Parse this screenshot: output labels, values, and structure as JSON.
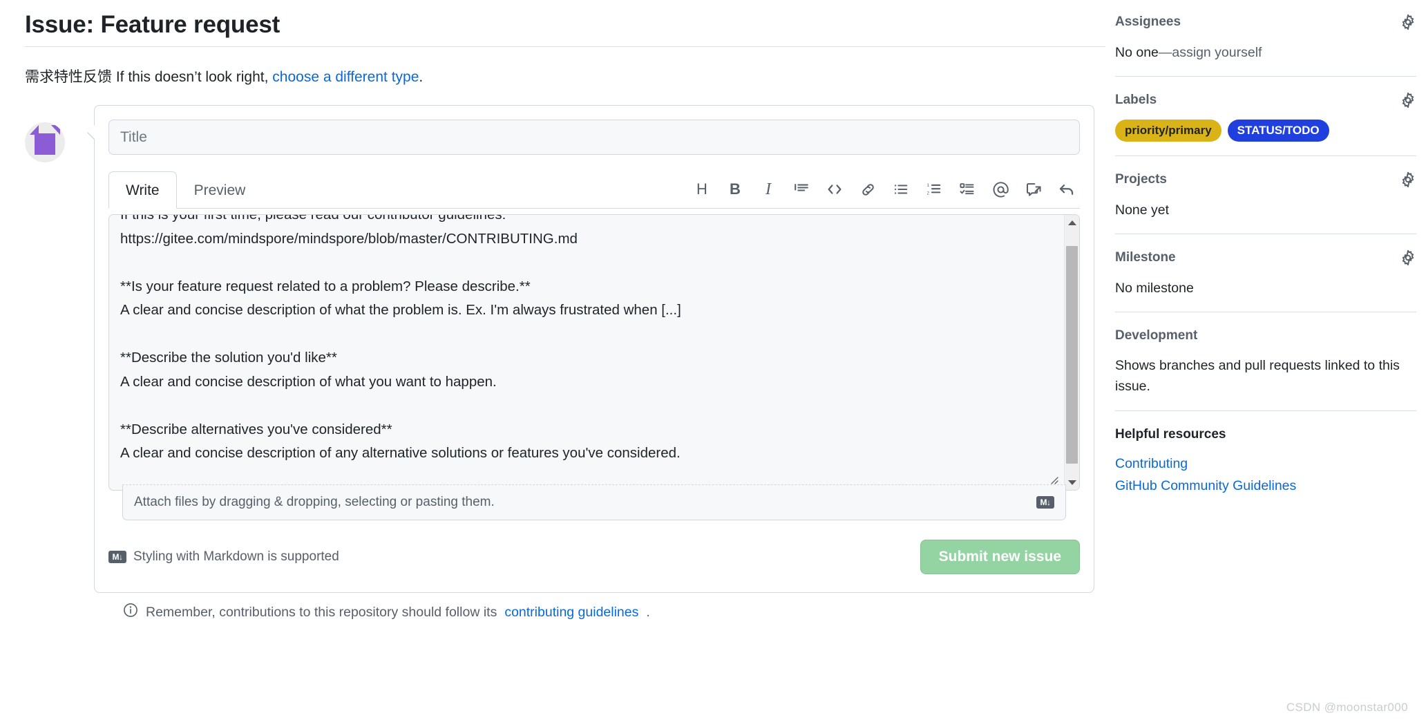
{
  "header": {
    "title": "Issue: Feature request",
    "subtitle_zh": "需求特性反馈",
    "subtitle_en": " If this doesn’t look right, ",
    "subtitle_link": "choose a different type",
    "subtitle_period": "."
  },
  "composer": {
    "title_placeholder": "Title",
    "tabs": [
      {
        "label": "Write",
        "active": true
      },
      {
        "label": "Preview",
        "active": false
      }
    ],
    "toolbar": [
      {
        "name": "heading-icon",
        "glyph": "H",
        "tooltip": "Add heading text"
      },
      {
        "name": "bold-icon",
        "glyph": "B",
        "tooltip": "Add bold text"
      },
      {
        "name": "italic-icon",
        "glyph": "I",
        "tooltip": "Add italic text"
      },
      {
        "name": "quote-icon",
        "glyph": "",
        "tooltip": "Add a quote"
      },
      {
        "name": "code-icon",
        "glyph": "<>",
        "tooltip": "Add code"
      },
      {
        "name": "link-icon",
        "glyph": "",
        "tooltip": "Add a link"
      },
      {
        "name": "unordered-list-icon",
        "glyph": "",
        "tooltip": "Add a bulleted list"
      },
      {
        "name": "ordered-list-icon",
        "glyph": "",
        "tooltip": "Add a numbered list"
      },
      {
        "name": "task-list-icon",
        "glyph": "",
        "tooltip": "Add a task list"
      },
      {
        "name": "mention-icon",
        "glyph": "@",
        "tooltip": "Directly mention a user or team"
      },
      {
        "name": "reference-icon",
        "glyph": "",
        "tooltip": "Reference an issue or pull request"
      },
      {
        "name": "saved-replies-icon",
        "glyph": "",
        "tooltip": "Add saved reply"
      }
    ],
    "body_text": "If this is your first time, please read our contributor guidelines:\nhttps://gitee.com/mindspore/mindspore/blob/master/CONTRIBUTING.md\n\n**Is your feature request related to a problem? Please describe.**\nA clear and concise description of what the problem is. Ex. I'm always frustrated when [...]\n\n**Describe the solution you'd like**\nA clear and concise description of what you want to happen.\n\n**Describe alternatives you've considered**\nA clear and concise description of any alternative solutions or features you've considered.\n\n**Additional context**\nAdd any other context or screenshots about the feature request here.",
    "attach_text": "Attach files by dragging & dropping, selecting or pasting them.",
    "markdown_badge": "M↓",
    "markdown_support": "Styling with Markdown is supported",
    "submit_label": "Submit new issue",
    "note_text": "Remember, contributions to this repository should follow its ",
    "note_link": "contributing guidelines",
    "note_period": "."
  },
  "sidebar": {
    "assignees": {
      "title": "Assignees",
      "value_prefix": "No one",
      "value_link": "—assign yourself"
    },
    "labels": {
      "title": "Labels",
      "chips": [
        {
          "text": "priority/primary",
          "bg": "#d9b318",
          "fg": "#1f2328"
        },
        {
          "text": "STATUS/TODO",
          "bg": "#1f3fdf",
          "fg": "#ffffff"
        }
      ]
    },
    "projects": {
      "title": "Projects",
      "value": "None yet"
    },
    "milestone": {
      "title": "Milestone",
      "value": "No milestone"
    },
    "development": {
      "title": "Development",
      "description": "Shows branches and pull requests linked to this issue."
    },
    "helpful_resources": {
      "title": "Helpful resources",
      "links": [
        "Contributing",
        "GitHub Community Guidelines"
      ]
    }
  },
  "watermark": "CSDN @moonstar000",
  "colors": {
    "accent_link": "#0969da",
    "submit_disabled": "#94d3a2",
    "border": "#d0d7de",
    "muted_text": "#57606a"
  }
}
